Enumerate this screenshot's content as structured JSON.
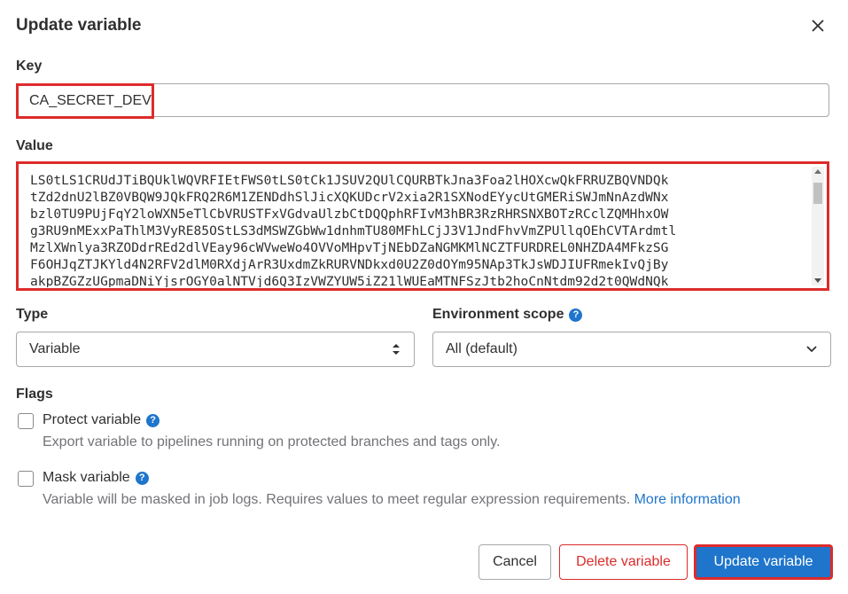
{
  "modal": {
    "title": "Update variable",
    "close_icon": "close-icon"
  },
  "key": {
    "label": "Key",
    "value": "CA_SECRET_DEV"
  },
  "value": {
    "label": "Value",
    "lines": [
      "LS0tLS1CRUdJTiBQUklWQVRFIEtFWS0tLS0tCk1JSUV2QUlCQURBTkJna3Foa2lHOXcwQkFRRUZBQVNDQk",
      "tZd2dnU2lBZ0VBQW9JQkFRQ2R6M1ZENDdhSlJicXQKUDcrV2xia2R1SXNodEYycUtGMERiSWJmNnAzdWNx",
      "bzl0TU9PUjFqY2loWXN5eTlCbVRUSTFxVGdvaUlzbCtDQQphRFIvM3hBR3RzRHRSNXBOTzRCclZQMHhxOW",
      "g3RU9nMExxPaThlM3VyRE85OStLS3dMSWZGbWw1dnhmTU80MFhLCjJ3V1JndFhvVmZPUllqOEhCVTArdmtl",
      "MzlXWnlya3RZODdrREd2dlVEay96cWVweWo4OVVoMHpvTjNEbDZaNGMKMlNCZTFURDREL0NHZDA4MFkzSG",
      "F6OHJqZTJKYld4N2RFV2dlM0RXdjArR3UxdmZkRURVNDkxd0U2Z0dOYm95NAp3TkJsWDJIUFRmekIvQjBy",
      "akpBZGZzUGpmaDNiYjsrOGY0alNTVjd6Q3IzVWZYUW5iZ21lWUEaMTNFSzJtb2hoCnNtdm92d2t0QWdNQk"
    ],
    "scroll_up_icon": "scroll-up-icon",
    "scroll_down_icon": "scroll-down-icon"
  },
  "type": {
    "label": "Type",
    "selected": "Variable",
    "icon": "sort-arrows-icon"
  },
  "scope": {
    "label": "Environment scope",
    "selected": "All (default)",
    "icon": "chevron-down-icon"
  },
  "flags": {
    "label": "Flags",
    "protect": {
      "title": "Protect variable",
      "help": "Export variable to pipelines running on protected branches and tags only."
    },
    "mask": {
      "title": "Mask variable",
      "help": "Variable will be masked in job logs. Requires values to meet regular expression requirements.",
      "link": "More information"
    }
  },
  "buttons": {
    "cancel": "Cancel",
    "delete": "Delete variable",
    "update": "Update variable"
  },
  "colors": {
    "accent": "#1f75cb",
    "danger": "#dd2b2b",
    "text": "#303030",
    "muted": "#737278"
  }
}
